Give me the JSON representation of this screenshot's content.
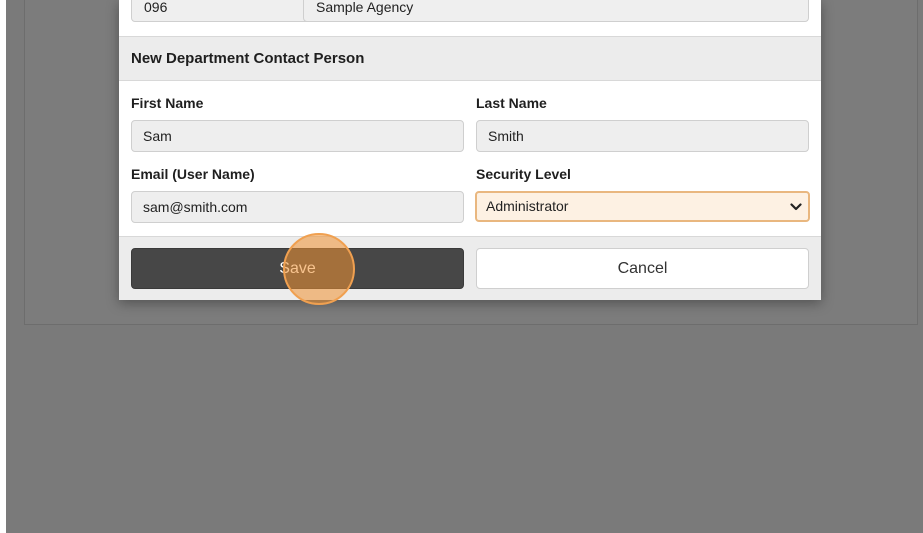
{
  "agency": {
    "code": "096",
    "name": "Sample Agency"
  },
  "section_title": "New Department Contact Person",
  "form": {
    "first_name": {
      "label": "First Name",
      "value": "Sam"
    },
    "last_name": {
      "label": "Last Name",
      "value": "Smith"
    },
    "email": {
      "label": "Email (User Name)",
      "value": "sam@smith.com"
    },
    "security_level": {
      "label": "Security Level",
      "value": "Administrator"
    }
  },
  "buttons": {
    "save": "Save",
    "cancel": "Cancel"
  },
  "colors": {
    "backdrop": "#7a7a7a",
    "save_bg": "#474747",
    "select_bg": "#fdf1e3",
    "select_border": "#e9b77f",
    "click_marker": "#f0a050"
  },
  "icons": {
    "select_arrow": "chevron-down-icon"
  }
}
